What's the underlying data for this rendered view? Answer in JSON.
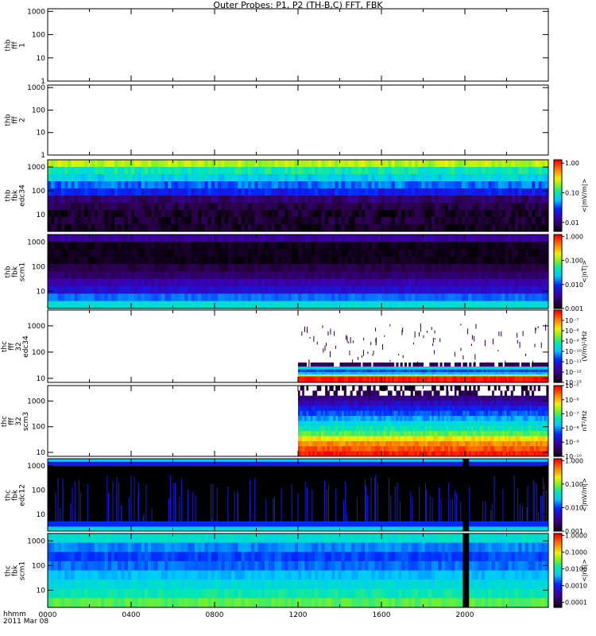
{
  "title": "Outer Probes: P1, P2 (TH-B,C) FFT, FBK",
  "chart_data": {
    "type": "heatmap",
    "x_axis": {
      "range": [
        "0000",
        "2400"
      ],
      "ticks": [
        "0000",
        "0400",
        "0800",
        "1200",
        "1600",
        "2000"
      ],
      "row_label": "hhmm",
      "date_label": "2011 Mar 08"
    },
    "panels": [
      {
        "name": "thb-fff-1",
        "label": [
          "thb",
          "fff",
          "1"
        ],
        "y_log": true,
        "ylim": [
          1,
          1300
        ],
        "yticks": [
          "1",
          "10",
          "100",
          "1000"
        ],
        "data": "none",
        "colorbar": null
      },
      {
        "name": "thb-fff-2",
        "label": [
          "thb",
          "fff",
          "2"
        ],
        "y_log": true,
        "ylim": [
          1,
          1300
        ],
        "yticks": [
          "1",
          "10",
          "100",
          "1000"
        ],
        "data": "none",
        "colorbar": null
      },
      {
        "name": "thb-fbk-edc34",
        "label": [
          "thb",
          "fbk",
          "edc34"
        ],
        "y_log": true,
        "ylim": [
          2,
          2000
        ],
        "yticks": [
          "10",
          "100",
          "1000"
        ],
        "data": "full",
        "bands": [
          0.7,
          0.55,
          0.48,
          0.38,
          0.3,
          0.13,
          0.08,
          0.05,
          0.06,
          0.04
        ],
        "colorbar": {
          "scale": "log",
          "range": [
            0.005,
            1.3
          ],
          "ticks": [
            "1.00",
            "0.10",
            "0.01"
          ],
          "label": "<|mV/m|>"
        }
      },
      {
        "name": "thb-fbk-scm1",
        "label": [
          "thb",
          "fbk",
          "scm1"
        ],
        "y_log": true,
        "ylim": [
          2,
          2000
        ],
        "yticks": [
          "10",
          "100",
          "1000"
        ],
        "data": "full",
        "bands": [
          0.82,
          0.97,
          0.97,
          0.97,
          0.92,
          0.88,
          0.8,
          0.75,
          0.62,
          0.48
        ],
        "colorbar": {
          "scale": "log",
          "range": [
            0.001,
            1.2
          ],
          "ticks": [
            "1.000",
            "0.100",
            "0.010",
            "0.001"
          ],
          "label": "<|nT|>"
        }
      },
      {
        "name": "thc-fff-32-edc34",
        "label": [
          "thc",
          "fff",
          "32",
          "edc34"
        ],
        "y_log": true,
        "ylim": [
          7,
          4000
        ],
        "yticks": [
          "10",
          "100",
          "1000"
        ],
        "data": "from_1200",
        "colorbar": {
          "scale": "log",
          "range": [
            1e-13,
            1e-06
          ],
          "ticks": [
            "10^-7",
            "10^-8",
            "10^-9",
            "10^-10",
            "10^-11",
            "10^-12",
            "10^-13"
          ],
          "label": "(V/m)^2/Hz"
        }
      },
      {
        "name": "thc-fff-32-scm3",
        "label": [
          "thc",
          "fff",
          "32",
          "scm3"
        ],
        "y_log": true,
        "ylim": [
          7,
          4000
        ],
        "yticks": [
          "10",
          "100",
          "1000"
        ],
        "data": "from_1200",
        "colorbar": {
          "scale": "log",
          "range": [
            1e-10,
            1e-05
          ],
          "ticks": [
            "10^-5",
            "10^-6",
            "10^-7",
            "10^-8",
            "10^-9",
            "10^-10"
          ],
          "label": "nT^2/Hz"
        }
      },
      {
        "name": "thc-fbk-edc12",
        "label": [
          "thc",
          "fbk",
          "edc12"
        ],
        "y_log": true,
        "ylim": [
          2,
          2000
        ],
        "yticks": [
          "10",
          "100",
          "1000"
        ],
        "data": "full",
        "colorbar": {
          "scale": "log",
          "range": [
            0.001,
            1.2
          ],
          "ticks": [
            "1.000",
            "0.100",
            "0.010",
            "0.001"
          ],
          "label": "<|mV/m|>"
        }
      },
      {
        "name": "thc-fbk-scm1",
        "label": [
          "thc",
          "fbk",
          "scm1"
        ],
        "y_log": true,
        "ylim": [
          2,
          2000
        ],
        "yticks": [
          "10",
          "100",
          "1000"
        ],
        "data": "full",
        "colorbar": {
          "scale": "log",
          "range": [
            5e-05,
            1.3
          ],
          "ticks": [
            "1.0000",
            "0.1000",
            "0.0100",
            "0.0010",
            "0.0001"
          ],
          "label": "<|nT|>"
        }
      }
    ]
  }
}
